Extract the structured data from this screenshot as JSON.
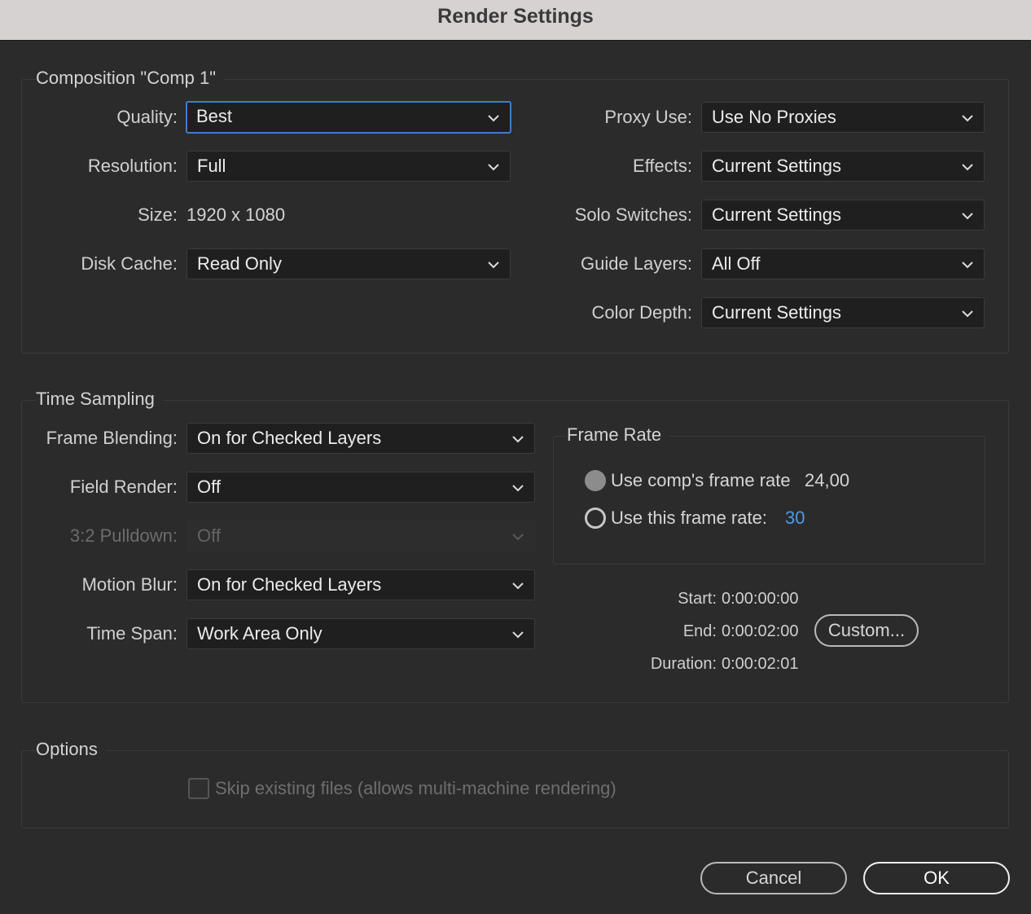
{
  "window": {
    "title": "Render Settings"
  },
  "composition": {
    "legend": "Composition \"Comp 1\"",
    "quality": {
      "label": "Quality:",
      "value": "Best"
    },
    "resolution": {
      "label": "Resolution:",
      "value": "Full"
    },
    "size": {
      "label": "Size:",
      "value": "1920 x 1080"
    },
    "disk_cache": {
      "label": "Disk Cache:",
      "value": "Read Only"
    },
    "proxy_use": {
      "label": "Proxy Use:",
      "value": "Use No Proxies"
    },
    "effects": {
      "label": "Effects:",
      "value": "Current Settings"
    },
    "solo_switches": {
      "label": "Solo Switches:",
      "value": "Current Settings"
    },
    "guide_layers": {
      "label": "Guide Layers:",
      "value": "All Off"
    },
    "color_depth": {
      "label": "Color Depth:",
      "value": "Current Settings"
    }
  },
  "time_sampling": {
    "legend": "Time Sampling",
    "frame_blending": {
      "label": "Frame Blending:",
      "value": "On for Checked Layers"
    },
    "field_render": {
      "label": "Field Render:",
      "value": "Off"
    },
    "pulldown": {
      "label": "3:2 Pulldown:",
      "value": "Off"
    },
    "motion_blur": {
      "label": "Motion Blur:",
      "value": "On for Checked Layers"
    },
    "time_span": {
      "label": "Time Span:",
      "value": "Work Area Only"
    },
    "frame_rate": {
      "legend": "Frame Rate",
      "use_comp": {
        "label": "Use comp's frame rate",
        "value": "24,00",
        "selected": true
      },
      "use_this": {
        "label": "Use this frame rate:",
        "value": "30",
        "selected": false
      }
    },
    "start": {
      "label": "Start:",
      "value": "0:00:00:00"
    },
    "end": {
      "label": "End:",
      "value": "0:00:02:00"
    },
    "duration": {
      "label": "Duration:",
      "value": "0:00:02:01"
    },
    "custom_button": "Custom..."
  },
  "options": {
    "legend": "Options",
    "skip_existing": {
      "label": "Skip existing files (allows multi-machine rendering)",
      "checked": false,
      "enabled": false
    }
  },
  "buttons": {
    "cancel": "Cancel",
    "ok": "OK"
  },
  "colors": {
    "accent_link": "#4a9be8",
    "focus_border": "#3d7fc9",
    "background": "#2b2b2b",
    "titlebar": "#d7d2d2"
  },
  "icons": {
    "dropdown": "chevron-down-icon"
  }
}
